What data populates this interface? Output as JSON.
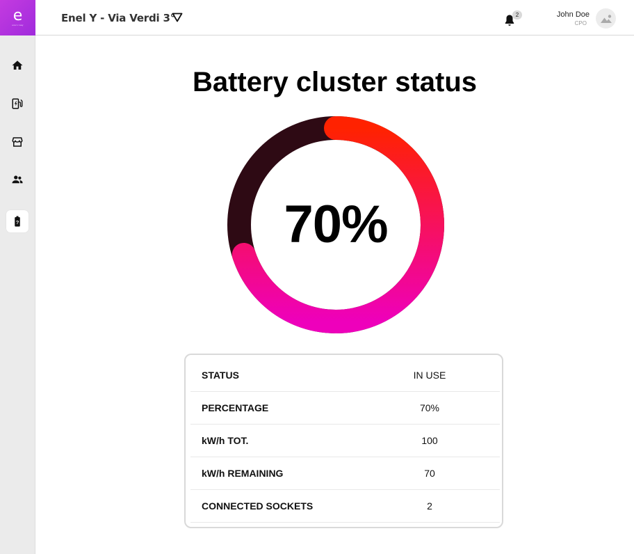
{
  "app": {
    "logo_text": "e",
    "logo_subtext": "enel x way"
  },
  "header": {
    "site_name": "Enel Y - Via Verdi 3°",
    "notification_count": "2",
    "user_name": "John Doe",
    "user_role": "CPO"
  },
  "sidebar": {
    "items": [
      {
        "id": "home",
        "icon": "home-icon",
        "active": false
      },
      {
        "id": "charging",
        "icon": "ev-station-icon",
        "active": false
      },
      {
        "id": "store",
        "icon": "storefront-icon",
        "active": false
      },
      {
        "id": "users",
        "icon": "people-icon",
        "active": false
      },
      {
        "id": "battery",
        "icon": "battery-unknown-icon",
        "active": true
      }
    ]
  },
  "main": {
    "title": "Battery cluster status",
    "gauge": {
      "value_label": "70%",
      "percent": 70,
      "track_color": "#2e0a14",
      "gradient_start": "#ff2200",
      "gradient_end": "#ee00bb"
    },
    "status_rows": [
      {
        "label": "STATUS",
        "value": "IN USE"
      },
      {
        "label": "PERCENTAGE",
        "value": "70%"
      },
      {
        "label": "kW/h TOT.",
        "value": "100"
      },
      {
        "label": "kW/h REMAINING",
        "value": "70"
      },
      {
        "label": "CONNECTED SOCKETS",
        "value": "2"
      }
    ]
  }
}
